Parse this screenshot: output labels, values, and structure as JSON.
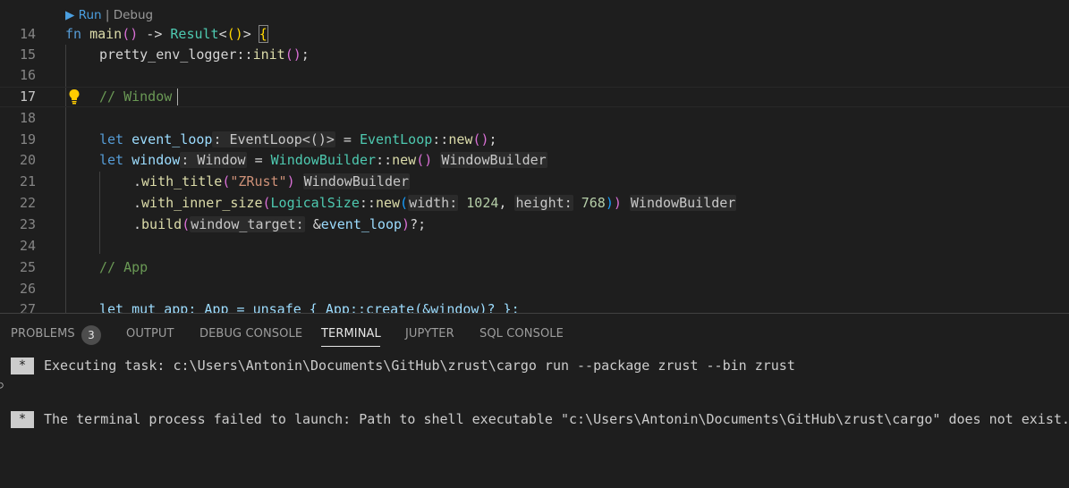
{
  "codelens": {
    "run": "▶ Run",
    "separator": " | ",
    "debug": "Debug"
  },
  "lines": [
    {
      "n": "14"
    },
    {
      "n": "15"
    },
    {
      "n": "16"
    },
    {
      "n": "17"
    },
    {
      "n": "18"
    },
    {
      "n": "19"
    },
    {
      "n": "20"
    },
    {
      "n": "21"
    },
    {
      "n": "22"
    },
    {
      "n": "23"
    },
    {
      "n": "24"
    },
    {
      "n": "25"
    },
    {
      "n": "26"
    },
    {
      "n": "27"
    }
  ],
  "code": {
    "l14": {
      "fn_kw": "fn",
      "name": "main",
      "sig": "()",
      "arrow": " -> ",
      "result": "Result",
      "lt": "<",
      "unit": "()",
      "gt": ">",
      "brace": "{"
    },
    "l15": {
      "path": "pretty_env_logger",
      "sep": "::",
      "call": "init",
      "parens": "()",
      "semi": ";"
    },
    "l17": {
      "comment": "// Window"
    },
    "l19": {
      "let": "let",
      "var": "event_loop",
      "hint": ": EventLoop<()>",
      "eq": " = ",
      "ty": "EventLoop",
      "sep": "::",
      "call": "new",
      "parens": "()",
      "semi": ";"
    },
    "l20": {
      "let": "let",
      "var": "window",
      "hint": ": Window",
      "eq": " = ",
      "ty": "WindowBuilder",
      "sep": "::",
      "call": "new",
      "parens": "()",
      "hint2": "WindowBuilder"
    },
    "l21": {
      "dot": ".",
      "call": "with_title",
      "open": "(",
      "str": "\"ZRust\"",
      "close": ")",
      "hint": "WindowBuilder"
    },
    "l22": {
      "dot": ".",
      "call": "with_inner_size",
      "open": "(",
      "ty": "LogicalSize",
      "sep": "::",
      "call2": "new",
      "open2": "(",
      "h1": "width:",
      "v1": "1024",
      "comma": ", ",
      "h2": "height:",
      "v2": "768",
      "close2": ")",
      "close": ")",
      "hint": "WindowBuilder"
    },
    "l23": {
      "dot": ".",
      "call": "build",
      "open": "(",
      "h1": "window_target:",
      "amp": "&",
      "var": "event_loop",
      "close": ")",
      "tail": "?;"
    },
    "l25": {
      "comment": "// App"
    },
    "l27": {
      "text": "let mut app: App = unsafe { App::create(&window)? };"
    }
  },
  "panel": {
    "tabs": [
      "PROBLEMS",
      "OUTPUT",
      "DEBUG CONSOLE",
      "TERMINAL",
      "JUPYTER",
      "SQL CONSOLE"
    ],
    "active_tab": "TERMINAL",
    "problems_count": "3"
  },
  "terminal": {
    "line1_marker": "*",
    "line1": "Executing task: c:\\Users\\Antonin\\Documents\\GitHub\\zrust\\cargo run --package zrust --bin zrust",
    "line2_marker": "*",
    "line2": "The terminal process failed to launch: Path to shell executable \"c:\\Users\\Antonin\\Documents\\GitHub\\zrust\\cargo\" does not exist."
  },
  "colors": {
    "keyword": "#569cd6",
    "function": "#dcdcaa",
    "type": "#4ec9b0",
    "variable": "#9cdcfe",
    "string": "#ce9178",
    "number": "#b5cea8",
    "comment": "#6a9955"
  }
}
